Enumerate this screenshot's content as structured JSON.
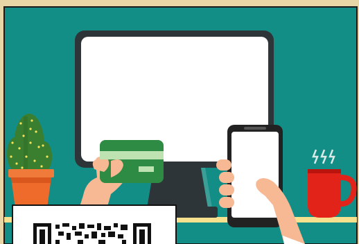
{
  "scene": {
    "description_icons": [
      "cactus-icon",
      "computer-monitor-icon",
      "credit-card-icon",
      "smartphone-icon",
      "coffee-mug-icon",
      "qr-code-icon"
    ],
    "colors": {
      "background_teal": "#138e86",
      "frame_tan": "#e8d6a6",
      "border_dark": "#222222",
      "monitor_body": "#2e3538",
      "monitor_screen": "#ffffff",
      "card_green": "#2e8b43",
      "card_stripe": "#bfe2b2",
      "skin": "#f7b894",
      "skin_shadow": "#e89a77",
      "sleeve_white": "#ffffff",
      "cactus_green": "#3a7e2f",
      "cactus_dots": "#f4e25a",
      "pot_orange": "#ee6b2b",
      "mug_red": "#e2231a",
      "steam": "#d8e9e7",
      "shelf_yellow": "#f7e18f",
      "qr_black": "#111111"
    }
  }
}
